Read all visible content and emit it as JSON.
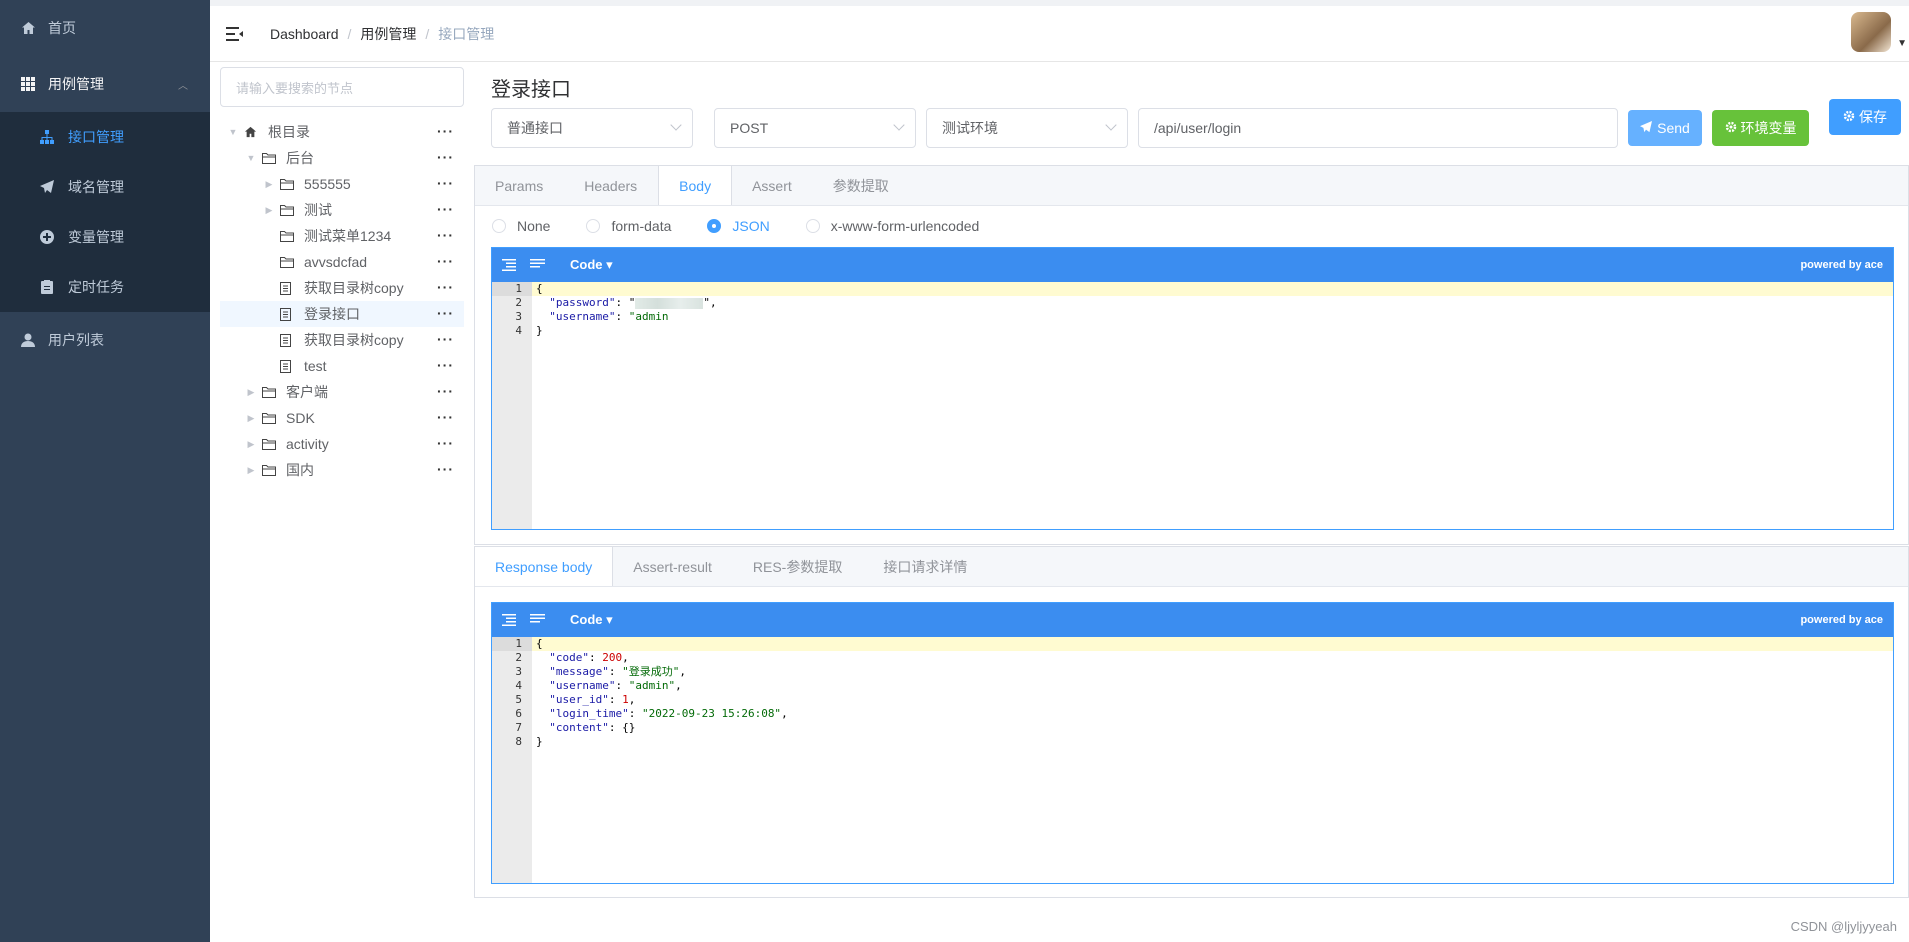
{
  "sidebar": {
    "home": "首页",
    "case_mgmt": "用例管理",
    "sub_items": [
      {
        "label": "接口管理",
        "icon": "sitemap-icon"
      },
      {
        "label": "域名管理",
        "icon": "paper-plane-icon"
      },
      {
        "label": "变量管理",
        "icon": "circle-plus-icon"
      },
      {
        "label": "定时任务",
        "icon": "clipboard-icon"
      }
    ],
    "user_list": "用户列表"
  },
  "breadcrumb": [
    "Dashboard",
    "用例管理",
    "接口管理"
  ],
  "tree": {
    "search_placeholder": "请输入要搜索的节点",
    "nodes": [
      {
        "label": "根目录"
      },
      {
        "label": "后台"
      },
      {
        "label": "555555"
      },
      {
        "label": "测试"
      },
      {
        "label": "测试菜单1234"
      },
      {
        "label": "avvsdcfad"
      },
      {
        "label": "获取目录树copy"
      },
      {
        "label": "登录接口"
      },
      {
        "label": "获取目录树copy"
      },
      {
        "label": "test"
      },
      {
        "label": "客户端"
      },
      {
        "label": "SDK"
      },
      {
        "label": "activity"
      },
      {
        "label": "国内"
      }
    ],
    "more": "···"
  },
  "api": {
    "title": "登录接口",
    "type": "普通接口",
    "method": "POST",
    "env": "测试环境",
    "url": "/api/user/login",
    "send": "Send",
    "env_vars": "环境变量",
    "save": "保存"
  },
  "request_tabs": [
    "Params",
    "Headers",
    "Body",
    "Assert",
    "参数提取"
  ],
  "body_types": [
    "None",
    "form-data",
    "JSON",
    "x-www-form-urlencoded"
  ],
  "editor": {
    "mode": "Code",
    "powered": "powered by ace"
  },
  "request_body": {
    "line_numbers": [
      "1",
      "2",
      "3",
      "4"
    ],
    "brace_open": "{",
    "brace_close": "}",
    "password_key": "\"password\"",
    "username_key": "\"username\"",
    "username_value": "\"admin"
  },
  "response_tabs": [
    "Response body",
    "Assert-result",
    "RES-参数提取",
    "接口请求详情"
  ],
  "response_body": {
    "line_numbers": [
      "1",
      "2",
      "3",
      "4",
      "5",
      "6",
      "7",
      "8"
    ],
    "code_key": "\"code\"",
    "code_value": "200",
    "message_key": "\"message\"",
    "message_value": "\"登录成功\"",
    "username_key": "\"username\"",
    "username_value": "\"admin\"",
    "user_id_key": "\"user_id\"",
    "user_id_value": "1",
    "login_time_key": "\"login_time\"",
    "login_time_value": "\"2022-09-23 15:26:08\"",
    "content_key": "\"content\"",
    "content_value": "{}"
  },
  "watermark": "CSDN @ljyljyyeah",
  "colors": {
    "sidebar": "#304156",
    "accent": "#409eff",
    "editor_bar": "#3b8df0",
    "success": "#67c23a"
  }
}
